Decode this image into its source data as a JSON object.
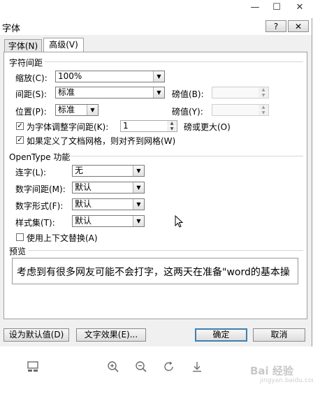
{
  "window": {
    "minimize": "—",
    "maximize": "☐",
    "close": "✕"
  },
  "dialog": {
    "title": "字体",
    "help_button": "?",
    "close_button": "✕",
    "tabs": [
      {
        "label": "字体(N)"
      },
      {
        "label": "高级(V)"
      }
    ],
    "char_spacing": {
      "group_title": "字符间距",
      "scale_label": "缩放(C):",
      "scale_value": "100%",
      "spacing_label": "间距(S):",
      "spacing_value": "标准",
      "spacing_by_label": "磅值(B):",
      "spacing_by_value": "",
      "position_label": "位置(P):",
      "position_value": "标准",
      "position_by_label": "磅值(Y):",
      "position_by_value": "",
      "kerning_label": "为字体调整字间距(K):",
      "kerning_checked": true,
      "kerning_value": "1",
      "kerning_suffix": "磅或更大(O)",
      "grid_label": "如果定义了文档网格，则对齐到网格(W)",
      "grid_checked": true
    },
    "opentype": {
      "group_title": "OpenType 功能",
      "ligatures_label": "连字(L):",
      "ligatures_value": "无",
      "num_spacing_label": "数字间距(M):",
      "num_spacing_value": "默认",
      "num_forms_label": "数字形式(F):",
      "num_forms_value": "默认",
      "stylistic_label": "样式集(T):",
      "stylistic_value": "默认",
      "contextual_label": "使用上下文替换(A)",
      "contextual_checked": false
    },
    "preview": {
      "group_title": "预览",
      "text": "考虑到有很多网友可能不会打字，这两天在准备\"word的基本操"
    },
    "buttons": {
      "set_default": "设为默认值(D)",
      "text_effects": "文字效果(E)...",
      "ok": "确定",
      "cancel": "取消"
    }
  },
  "viewer_toolbar": {
    "icons": [
      "layout-icon",
      "zoom-in-icon",
      "zoom-out-icon",
      "rotate-icon",
      "download-icon"
    ]
  },
  "watermark": {
    "text": "Bai 经验",
    "sub": "jingyan.baidu.com"
  }
}
